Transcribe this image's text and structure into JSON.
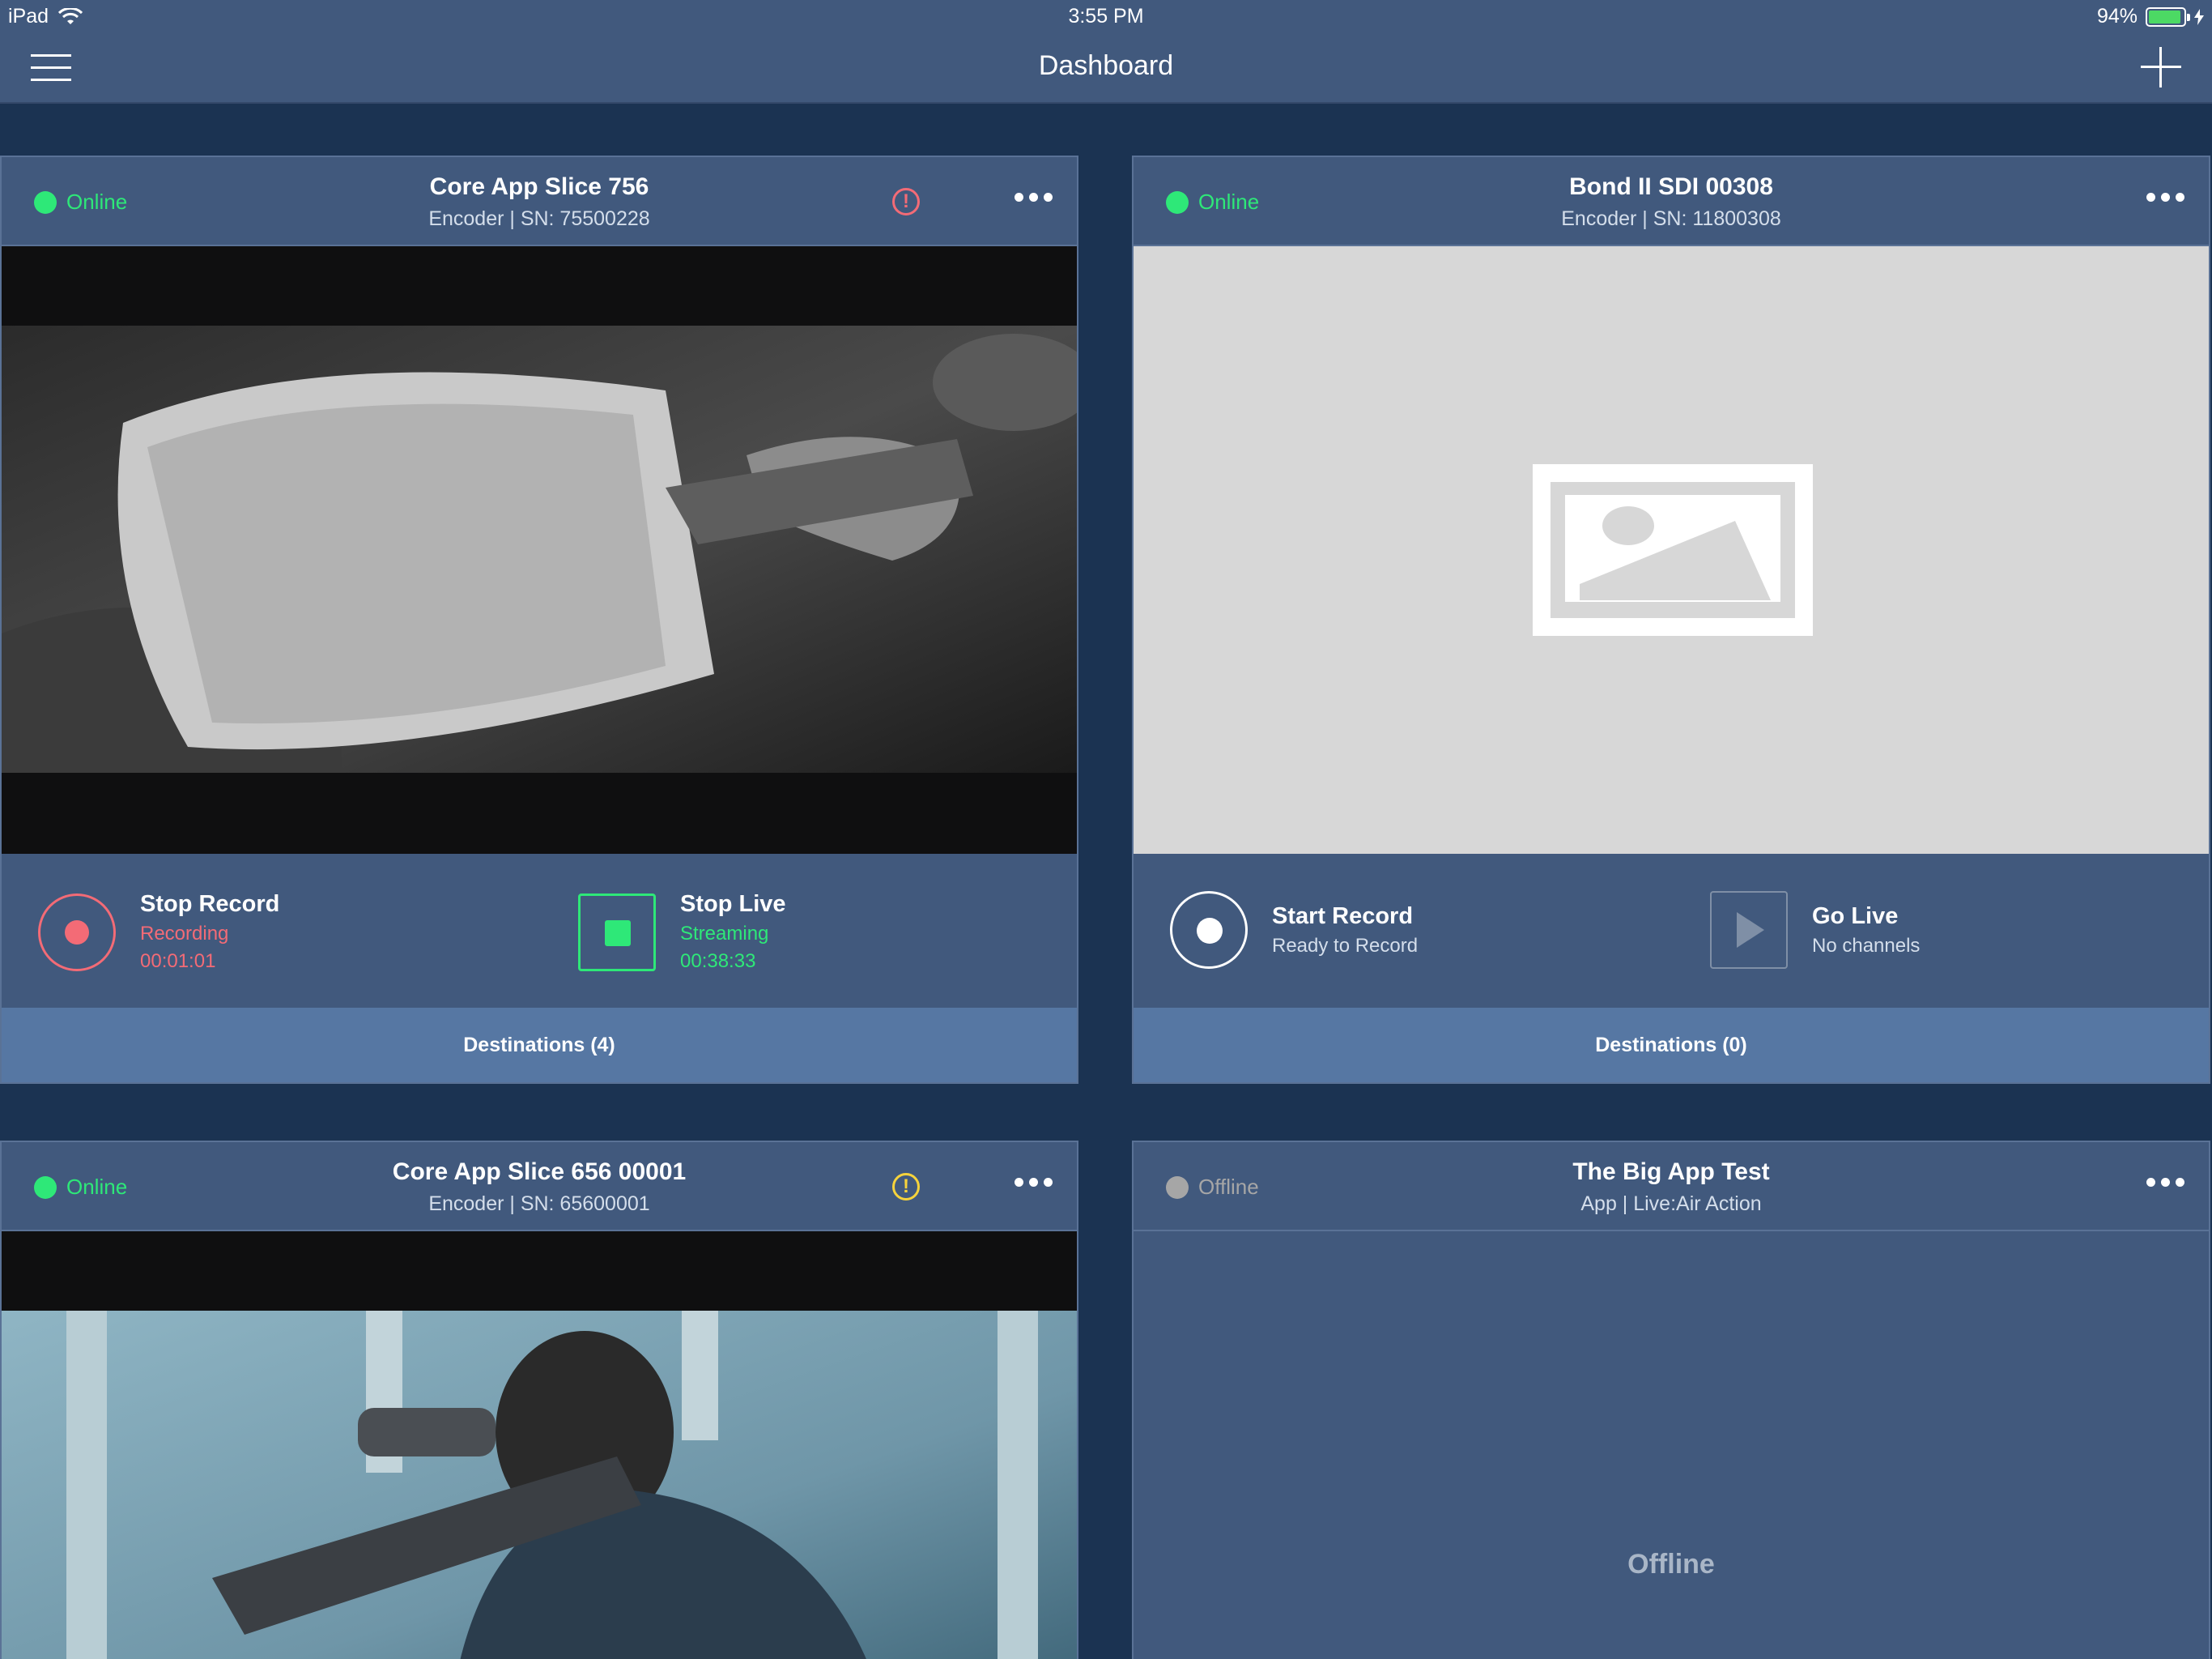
{
  "statusbar": {
    "device": "iPad",
    "time": "3:55 PM",
    "battery": "94%"
  },
  "nav": {
    "title": "Dashboard"
  },
  "colors": {
    "online": "#2ee878",
    "offline": "#a6a6a6",
    "record_red": "#f36b76",
    "live_green": "#2ee878",
    "warn_yellow": "#f6d33c"
  },
  "cards": [
    {
      "status": "Online",
      "title": "Core App Slice 756",
      "subtitle": "Encoder | SN: 75500228",
      "record": {
        "label": "Stop Record",
        "state": "Recording",
        "time": "00:01:01"
      },
      "live": {
        "label": "Stop Live",
        "state": "Streaming",
        "time": "00:38:33"
      },
      "destinations": "Destinations (4)"
    },
    {
      "status": "Online",
      "title": "Bond II SDI 00308",
      "subtitle": "Encoder | SN: 11800308",
      "record": {
        "label": "Start Record",
        "state": "Ready to Record"
      },
      "live": {
        "label": "Go Live",
        "state": "No channels"
      },
      "destinations": "Destinations (0)"
    },
    {
      "status": "Online",
      "title": "Core App Slice 656 00001",
      "subtitle": "Encoder | SN: 65600001"
    },
    {
      "status": "Offline",
      "title": "The Big  App Test",
      "subtitle": "App | Live:Air Action",
      "body": "Offline"
    }
  ]
}
